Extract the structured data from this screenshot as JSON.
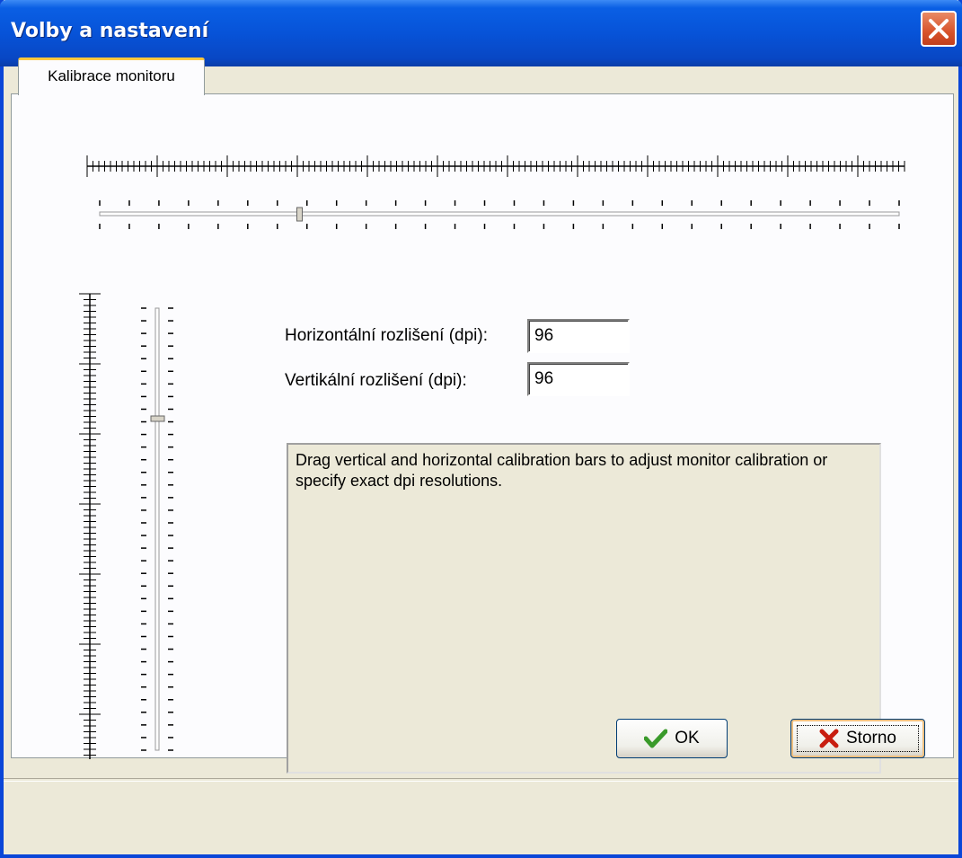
{
  "window": {
    "title": "Volby a nastavení"
  },
  "tabs": [
    {
      "label": "Kalibrace monitoru"
    }
  ],
  "calibration": {
    "horizontal_label": "Horizontální rozlišení (dpi):",
    "horizontal_value": "96",
    "vertical_label": "Vertikální rozlišení (dpi):",
    "vertical_value": "96",
    "horizontal_slider_fraction": 0.25,
    "vertical_slider_fraction": 0.25
  },
  "info_text": "Drag vertical and horizontal calibration bars to adjust monitor calibration or specify exact dpi resolutions.",
  "buttons": {
    "ok": "OK",
    "cancel": "Storno"
  },
  "icons": {
    "close": "close-icon",
    "ok": "checkmark-icon",
    "cancel": "x-mark-icon"
  },
  "colors": {
    "title_bar": "#0a5fe4",
    "close": "#d8532b",
    "tab_highlight": "#ffc83c",
    "ok_icon": "#3a9a2a",
    "cancel_icon": "#c81e10"
  }
}
